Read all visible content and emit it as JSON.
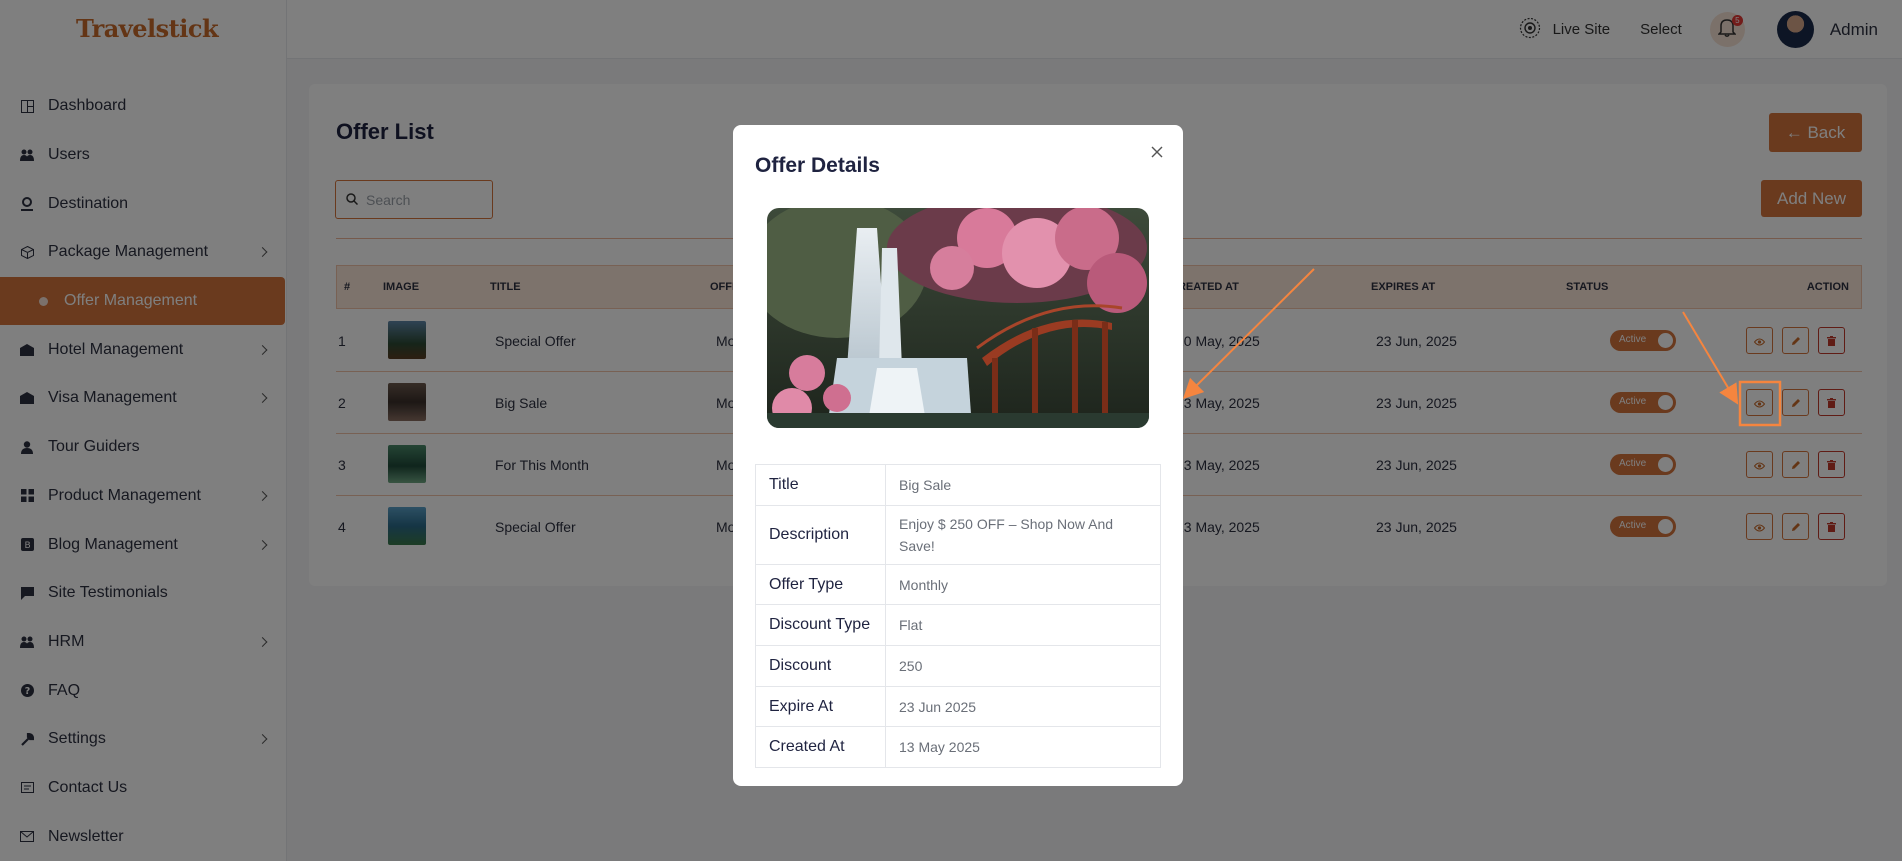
{
  "brand": {
    "logo_text": "Travelstick"
  },
  "header": {
    "live_site": "Live Site",
    "select": "Select",
    "notification_count": "5",
    "user_name": "Admin"
  },
  "sidebar": {
    "items": [
      {
        "label": "Dashboard",
        "icon": "dashboard-icon",
        "submenu": false
      },
      {
        "label": "Users",
        "icon": "users-icon",
        "submenu": false
      },
      {
        "label": "Destination",
        "icon": "location-icon",
        "submenu": false
      },
      {
        "label": "Package Management",
        "icon": "package-icon",
        "submenu": true
      },
      {
        "label": "Offer Management",
        "icon": "dot-icon",
        "submenu": false,
        "active": true
      },
      {
        "label": "Hotel Management",
        "icon": "hotel-icon",
        "submenu": true
      },
      {
        "label": "Visa Management",
        "icon": "visa-icon",
        "submenu": true
      },
      {
        "label": "Tour Guiders",
        "icon": "guide-icon",
        "submenu": false
      },
      {
        "label": "Product Management",
        "icon": "product-icon",
        "submenu": true
      },
      {
        "label": "Blog Management",
        "icon": "blog-icon",
        "submenu": true
      },
      {
        "label": "Site Testimonials",
        "icon": "testimonial-icon",
        "submenu": false
      },
      {
        "label": "HRM",
        "icon": "hrm-icon",
        "submenu": true
      },
      {
        "label": "FAQ",
        "icon": "faq-icon",
        "submenu": false
      },
      {
        "label": "Settings",
        "icon": "settings-icon",
        "submenu": true
      },
      {
        "label": "Contact Us",
        "icon": "contact-icon",
        "submenu": false
      },
      {
        "label": "Newsletter",
        "icon": "newsletter-icon",
        "submenu": false
      }
    ]
  },
  "main": {
    "title": "Offer List",
    "search_placeholder": "Search",
    "back_label": "← Back",
    "add_label": "Add New",
    "columns": [
      "#",
      "IMAGE",
      "TITLE",
      "OFFER TYPE",
      "CREATED AT",
      "EXPIRES AT",
      "STATUS",
      "ACTION"
    ],
    "rows": [
      {
        "num": "1",
        "title": "Special Offer",
        "type": "Monthly",
        "created": "20 May, 2025",
        "expires": "23 Jun, 2025",
        "status": "Active"
      },
      {
        "num": "2",
        "title": "Big Sale",
        "type": "Monthly",
        "created": "13 May, 2025",
        "expires": "23 Jun, 2025",
        "status": "Active"
      },
      {
        "num": "3",
        "title": "For This Month",
        "type": "Monthly",
        "created": "13 May, 2025",
        "expires": "23 Jun, 2025",
        "status": "Active"
      },
      {
        "num": "4",
        "title": "Special Offer",
        "type": "Monthly",
        "created": "13 May, 2025",
        "expires": "23 Jun, 2025",
        "status": "Active"
      }
    ]
  },
  "modal": {
    "title": "Offer Details",
    "details": [
      {
        "key": "Title",
        "value": "Big Sale"
      },
      {
        "key": "Description",
        "value": "Enjoy $ 250 OFF – Shop Now And Save!"
      },
      {
        "key": "Offer Type",
        "value": "Monthly"
      },
      {
        "key": "Discount Type",
        "value": "Flat"
      },
      {
        "key": "Discount",
        "value": "250"
      },
      {
        "key": "Expire At",
        "value": "23 Jun 2025"
      },
      {
        "key": "Created At",
        "value": "13 May 2025"
      }
    ]
  },
  "colors": {
    "accent": "#d4743d",
    "accent_light": "#fbe6d9",
    "danger": "#c0392b"
  }
}
